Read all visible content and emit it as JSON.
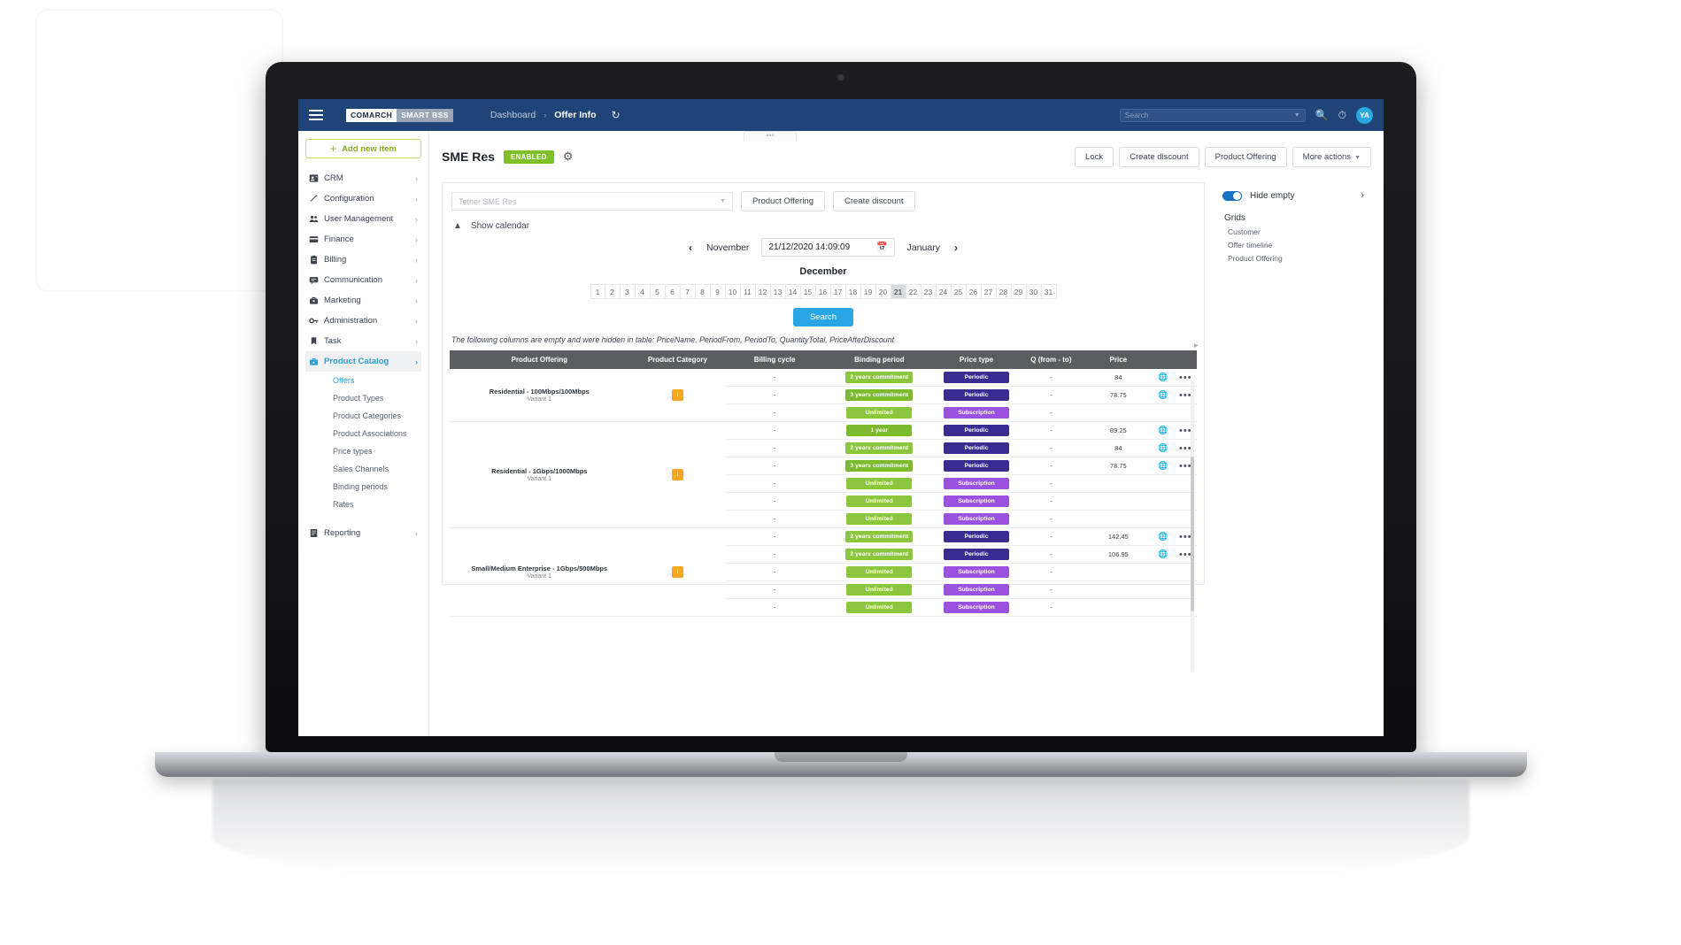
{
  "header": {
    "logo_primary": "COMARCH",
    "logo_secondary": "SMART BSS",
    "breadcrumb": [
      "Dashboard",
      "Offer Info"
    ],
    "breadcrumb_separator": "›",
    "refresh_icon": "refresh-icon",
    "search_placeholder": "Search",
    "avatar_initials": "YA"
  },
  "sidebar": {
    "add_new_label": "Add new item",
    "items": [
      {
        "label": "CRM",
        "icon": "contacts-icon"
      },
      {
        "label": "Configuration",
        "icon": "pencil-icon"
      },
      {
        "label": "User Management",
        "icon": "users-icon"
      },
      {
        "label": "Finance",
        "icon": "card-icon"
      },
      {
        "label": "Billing",
        "icon": "clipboard-icon"
      },
      {
        "label": "Communication",
        "icon": "chat-icon"
      },
      {
        "label": "Marketing",
        "icon": "briefcase-icon"
      },
      {
        "label": "Administration",
        "icon": "key-icon"
      },
      {
        "label": "Task",
        "icon": "bookmark-icon"
      },
      {
        "label": "Product Catalog",
        "icon": "catalog-icon"
      }
    ],
    "sub_items": [
      "Offers",
      "Product Types",
      "Product Categories",
      "Product Associations",
      "Price types",
      "Sales Channels",
      "Binding periods",
      "Rates"
    ],
    "selected_sub_item": "Offers",
    "reporting": {
      "label": "Reporting",
      "icon": "report-icon"
    }
  },
  "page": {
    "title": "SME Res",
    "status_badge": "ENABLED",
    "gear_icon": "gear-icon",
    "action_buttons": [
      "Lock",
      "Create discount",
      "Product Offering"
    ],
    "more_actions_label": "More actions"
  },
  "panel": {
    "tether_placeholder": "Tether SME Res",
    "buttons": [
      "Product Offering",
      "Create discount"
    ],
    "show_calendar_label": "Show calendar",
    "calendar": {
      "prev_month": "November",
      "next_month": "January",
      "date_value": "21/12/2020 14:09:09",
      "current_month": "December",
      "days": [
        "1",
        "2",
        "3",
        "4",
        "5",
        "6",
        "7",
        "8",
        "9",
        "10",
        "11",
        "12",
        "13",
        "14",
        "15",
        "16",
        "17",
        "18",
        "19",
        "20",
        "21",
        "22",
        "23",
        "24",
        "25",
        "26",
        "27",
        "28",
        "29",
        "30",
        "31"
      ],
      "selected_day": "21",
      "search_label": "Search"
    },
    "hidden_columns_note": "The following columns are empty and were hidden in table: PriceName, PeriodFrom, PeriodTo, QuantityTotal, PriceAfterDiscount"
  },
  "grid": {
    "columns": [
      "Product Offering",
      "Product Category",
      "Billing cycle",
      "Binding period",
      "Price type",
      "Q (from - to)",
      "Price"
    ],
    "groups": [
      {
        "offering": "Residential - 100Mbps/100Mbps",
        "variant": "Variant 1",
        "category_badge": "i",
        "rows": [
          {
            "billing": "-",
            "binding": "2 years commitment",
            "binding_style": "green",
            "price_type": "Periodic",
            "price_type_style": "navy",
            "qty": "-",
            "price": "84",
            "globe": true,
            "menu": true
          },
          {
            "billing": "-",
            "binding": "3 years commitment",
            "binding_style": "dgreen",
            "price_type": "Periodic",
            "price_type_style": "navy",
            "qty": "-",
            "price": "78.75",
            "globe": true,
            "menu": true
          },
          {
            "billing": "-",
            "binding": "Unlimited",
            "binding_style": "green",
            "price_type": "Subscription",
            "price_type_style": "purple",
            "qty": "-",
            "price": "",
            "globe": false,
            "menu": false
          }
        ]
      },
      {
        "offering": "Residential - 1Gbps/1000Mbps",
        "variant": "Variant 1",
        "category_badge": "i",
        "rows": [
          {
            "billing": "-",
            "binding": "1 year",
            "binding_style": "dgreen",
            "price_type": "Periodic",
            "price_type_style": "navy",
            "qty": "-",
            "price": "89.25",
            "globe": true,
            "menu": true
          },
          {
            "billing": "-",
            "binding": "2 years commitment",
            "binding_style": "green",
            "price_type": "Periodic",
            "price_type_style": "navy",
            "qty": "-",
            "price": "84",
            "globe": true,
            "menu": true
          },
          {
            "billing": "-",
            "binding": "3 years commitment",
            "binding_style": "dgreen",
            "price_type": "Periodic",
            "price_type_style": "navy",
            "qty": "-",
            "price": "78.75",
            "globe": true,
            "menu": true
          },
          {
            "billing": "-",
            "binding": "Unlimited",
            "binding_style": "green",
            "price_type": "Subscription",
            "price_type_style": "purple",
            "qty": "-",
            "price": "",
            "globe": false,
            "menu": false
          },
          {
            "billing": "-",
            "binding": "Unlimited",
            "binding_style": "green",
            "price_type": "Subscription",
            "price_type_style": "purple",
            "qty": "-",
            "price": "",
            "globe": false,
            "menu": false
          },
          {
            "billing": "-",
            "binding": "Unlimited",
            "binding_style": "green",
            "price_type": "Subscription",
            "price_type_style": "purple",
            "qty": "-",
            "price": "",
            "globe": false,
            "menu": false
          }
        ]
      },
      {
        "offering": "Small/Medium Enterprise - 1Gbps/500Mbps",
        "variant": "Variant 1",
        "category_badge": "i",
        "rows": [
          {
            "billing": "-",
            "binding": "2 years commitment",
            "binding_style": "green",
            "price_type": "Periodic",
            "price_type_style": "navy",
            "qty": "-",
            "price": "142.45",
            "globe": true,
            "menu": true
          },
          {
            "billing": "-",
            "binding": "2 years commitment",
            "binding_style": "green",
            "price_type": "Periodic",
            "price_type_style": "navy",
            "qty": "-",
            "price": "106.95",
            "globe": true,
            "menu": true
          },
          {
            "billing": "-",
            "binding": "Unlimited",
            "binding_style": "green",
            "price_type": "Subscription",
            "price_type_style": "purple",
            "qty": "-",
            "price": "",
            "globe": false,
            "menu": false
          },
          {
            "billing": "-",
            "binding": "Unlimited",
            "binding_style": "green",
            "price_type": "Subscription",
            "price_type_style": "purple",
            "qty": "-",
            "price": "",
            "globe": false,
            "menu": false
          },
          {
            "billing": "-",
            "binding": "Unlimited",
            "binding_style": "green",
            "price_type": "Subscription",
            "price_type_style": "purple",
            "qty": "-",
            "price": "",
            "globe": false,
            "menu": false
          }
        ]
      }
    ]
  },
  "right_panel": {
    "hide_empty_label": "Hide empty",
    "hide_empty_on": true,
    "expand_icon": "chevron-right-icon",
    "grids_title": "Grids",
    "grid_links": [
      "Customer",
      "Offer timeline",
      "Product Offering"
    ]
  },
  "colors": {
    "header_navy": "#1f4478",
    "accent_blue": "#29a5e3",
    "green_badge": "#7fbf2a",
    "orange_badge": "#f5a623",
    "purple_pill": "#9b51e0",
    "navy_pill": "#3b2d8f"
  }
}
